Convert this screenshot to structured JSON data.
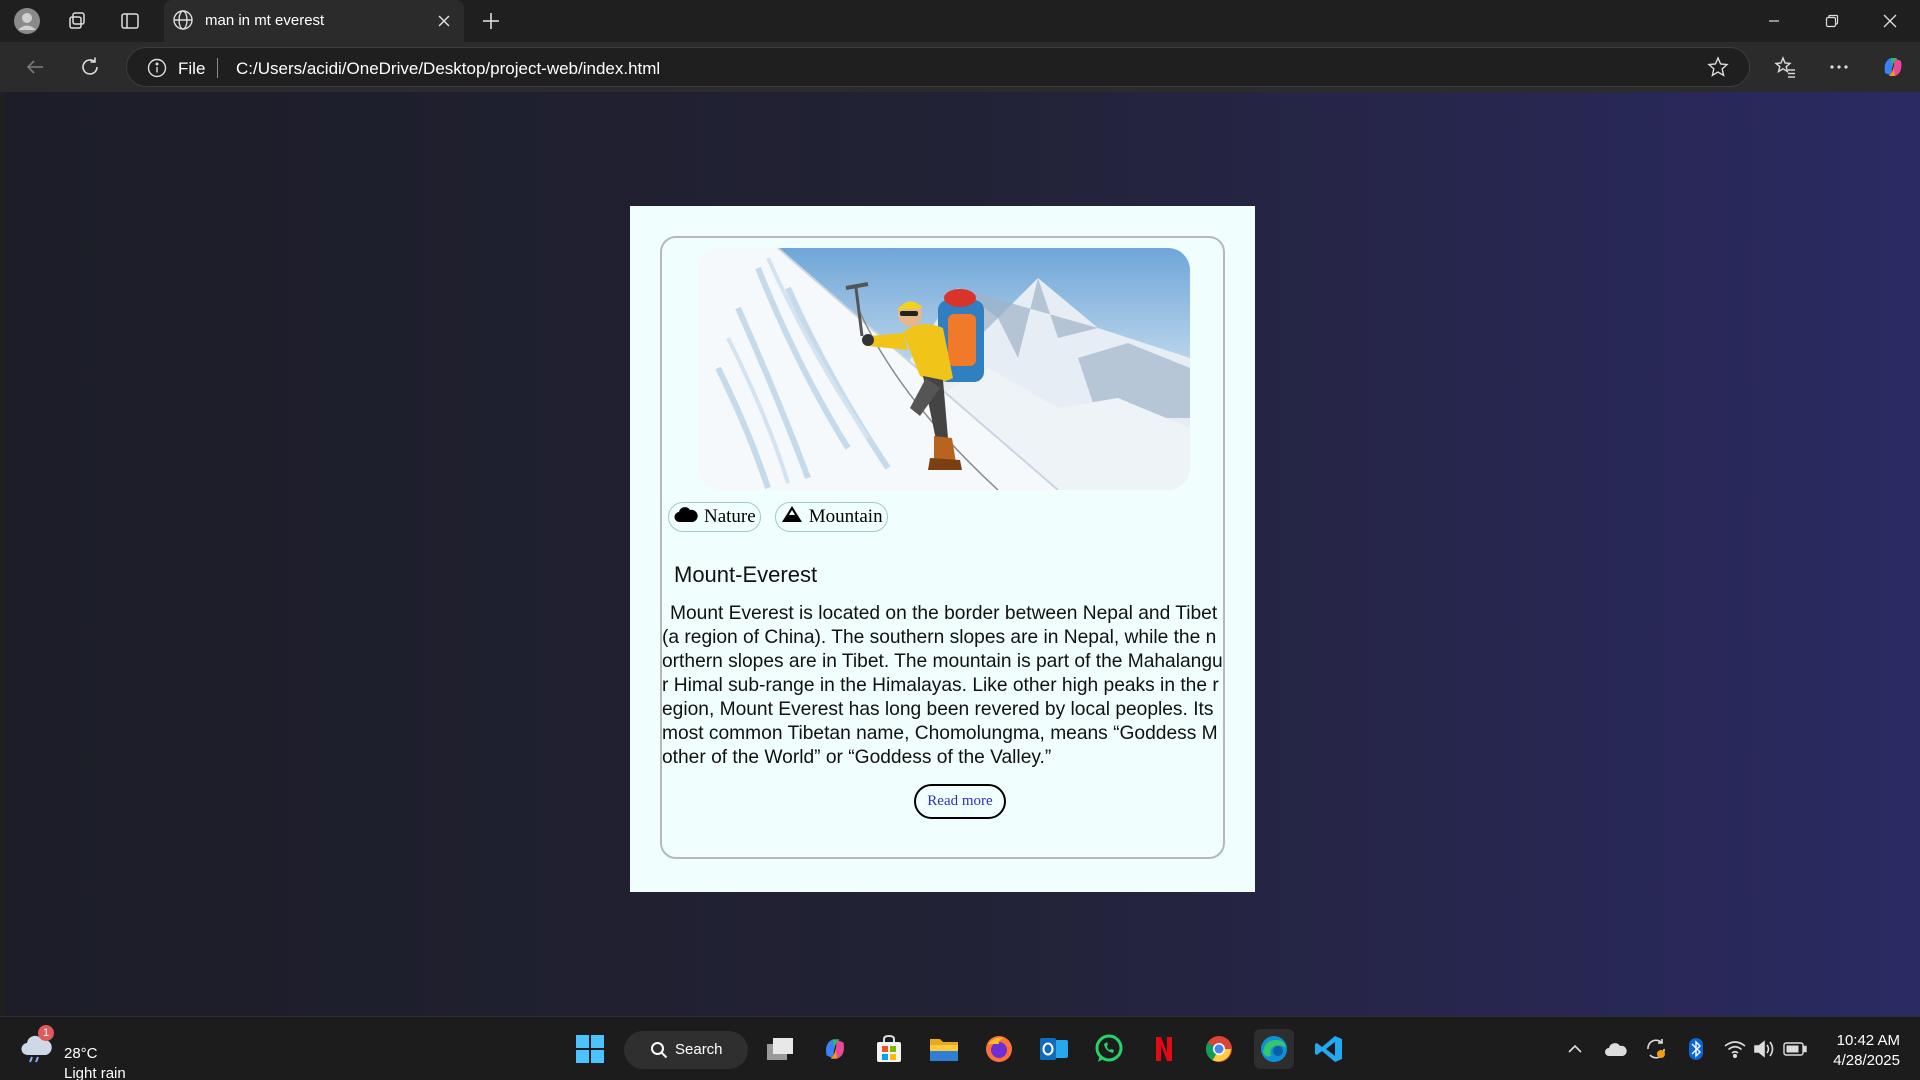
{
  "browser": {
    "tab_title": "man in mt everest",
    "address_scheme_label": "File",
    "url": "C:/Users/acidi/OneDrive/Desktop/project-web/index.html"
  },
  "card": {
    "tags": [
      {
        "label": "Nature",
        "icon": "cloud-icon"
      },
      {
        "label": "Mountain",
        "icon": "mountain-icon"
      }
    ],
    "title": "Mount-Everest",
    "body": "Mount Everest is located on the border between Nepal and Tibet (a region of China). The southern slopes are in Nepal, while the northern slopes are in Tibet. The mountain is part of the Mahalangur Himal sub-range in the Himalayas. Like other high peaks in the region, Mount Everest has long been revered by local peoples. Its most common Tibetan name, Chomolungma, means “Goddess Mother of the World” or “Goddess of the Valley.”",
    "read_more_label": "Read more"
  },
  "taskbar": {
    "weather_badge": "1",
    "temperature": "28°C",
    "weather_condition": "Light rain",
    "search_label": "Search",
    "time": "10:42 AM",
    "date": "4/28/2025"
  },
  "colors": {
    "page_bg": "#f0fffe",
    "read_more_text": "#2f2fbf",
    "gradient_start": "#1c1d27",
    "gradient_end": "#2b2a63"
  }
}
